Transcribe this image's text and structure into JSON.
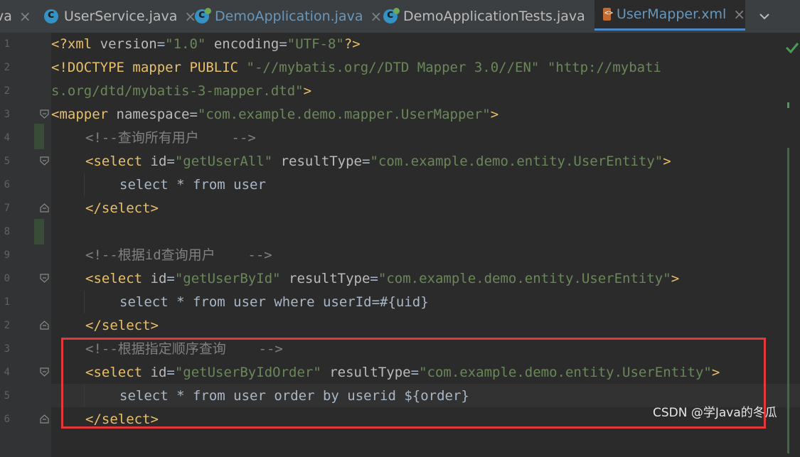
{
  "tabs": [
    {
      "label": "va",
      "type": "partial"
    },
    {
      "label": "UserService.java",
      "type": "java"
    },
    {
      "label": "DemoApplication.java",
      "type": "java-spring"
    },
    {
      "label": "DemoApplicationTests.java",
      "type": "java-spring"
    },
    {
      "label": "UserMapper.xml",
      "type": "xml",
      "active": true
    }
  ],
  "tab_close_glyph": "×",
  "tab_overflow_icon": "chevron-down-icon",
  "gutter": {
    "line_numbers": [
      "1",
      "2",
      "3",
      "4",
      "5",
      "6",
      "7",
      "8",
      "9",
      "0",
      "1",
      "2",
      "3",
      "4",
      "5",
      "6",
      "7"
    ]
  },
  "code": {
    "line1": {
      "a": "<?xml ",
      "b": "version",
      "c": "=",
      "d": "\"1.0\"",
      "e": " encoding",
      "f": "=",
      "g": "\"UTF-8\"",
      "h": "?>"
    },
    "line2": {
      "a": "<!DOCTYPE mapper PUBLIC ",
      "b": "\"-//mybatis.org//DTD Mapper 3.0//EN\"",
      "c": " ",
      "d": "\"http://mybati"
    },
    "line3": {
      "a": "s.org/dtd/mybatis-3-mapper.dtd\"",
      "b": ">"
    },
    "line4": {
      "a": "<mapper ",
      "b": "namespace",
      "c": "=",
      "d": "\"com.example.demo.mapper.UserMapper\"",
      "e": ">"
    },
    "line5": {
      "a": "<!--查询所有用户    -->"
    },
    "line6": {
      "a": "<select ",
      "b": "id",
      "c": "=",
      "d": "\"getUserAll\"",
      "e": " resultType",
      "f": "=",
      "g": "\"com.example.demo.entity.UserEntity\"",
      "h": ">"
    },
    "line7": {
      "a": "select * from user"
    },
    "line8": {
      "a": "</select>"
    },
    "line10": {
      "a": "<!--根据id查询用户    -->"
    },
    "line11": {
      "a": "<select ",
      "b": "id",
      "c": "=",
      "d": "\"getUserById\"",
      "e": " resultType",
      "f": "=",
      "g": "\"com.example.demo.entity.UserEntity\"",
      "h": ">"
    },
    "line12": {
      "a": "select * from user where userId=#{uid}"
    },
    "line13": {
      "a": "</select>"
    },
    "line14": {
      "a": "<!--根据指定顺序查询    -->"
    },
    "line15": {
      "a": "<select ",
      "b": "id",
      "c": "=",
      "d": "\"getUserByIdOrder\"",
      "e": " resultType",
      "f": "=",
      "g": "\"com.example.demo.entity.UserEntity\"",
      "h": ">"
    },
    "line16": {
      "a": "select * from user order by userid ${order}"
    },
    "line17": {
      "a": "</select>"
    }
  },
  "inspection_status_icon": "check-icon",
  "watermark": "CSDN @学Java的冬瓜",
  "colors": {
    "tag": "#e8bf6a",
    "attribute": "#bababa",
    "string": "#6a8759",
    "comment": "#808080",
    "plain": "#a9b7c6",
    "active_tab": "#6897bb",
    "highlight_box": "#e4393c",
    "check": "#499c54"
  }
}
